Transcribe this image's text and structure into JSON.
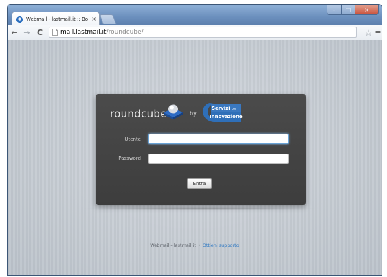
{
  "browser": {
    "tab_title": "Webmail - lastmail.it :: Bo",
    "tab_close": "×",
    "url_host": "mail.lastmail.it",
    "url_path": "/roundcube/",
    "icons": {
      "back": "←",
      "forward": "→",
      "reload": "C",
      "star": "☆",
      "menu": "≡",
      "minimize": "–",
      "maximize": "□",
      "close": "×"
    }
  },
  "login": {
    "logo_text": "roundcube",
    "by_text": "by",
    "partner_line1": "Servizi",
    "partner_small": "per",
    "partner_line2": "Innovazione",
    "username_label": "Utente",
    "username_value": "",
    "password_label": "Password",
    "password_value": "",
    "submit_label": "Entra"
  },
  "footer": {
    "text": "Webmail - lastmail.it",
    "separator": "•",
    "link_label": "Ottieni supporto"
  },
  "colors": {
    "panel": "#444444",
    "link": "#2e78c2",
    "window_frame": "#6d8fb8"
  }
}
